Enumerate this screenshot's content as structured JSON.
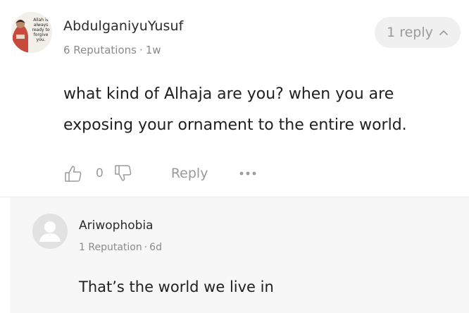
{
  "comment": {
    "author": "AbdulganiyuYusuf",
    "avatar_caption": "Allah is always ready to forgive you.",
    "reputation": "6 Reputations",
    "separator": "·",
    "age": "1w",
    "replies_label": "1 reply",
    "text": "what kind of Alhaja are you? when you are exposing your ornament to the entire world.",
    "likes": "0",
    "reply_label": "Reply"
  },
  "reply": {
    "author": "Ariwophobia",
    "reputation": "1 Reputation",
    "separator": "·",
    "age": "6d",
    "text": "That’s the world we live in"
  },
  "icons": {
    "like": "thumbs-up-icon",
    "dislike": "thumbs-down-icon",
    "more": "more-dots-icon",
    "collapse": "chevron-up-icon",
    "default_avatar": "user-silhouette-icon"
  },
  "colors": {
    "muted_text": "#9a9a9a",
    "pill_bg": "#f0f0f0",
    "reply_bg": "#f7f7f7"
  }
}
